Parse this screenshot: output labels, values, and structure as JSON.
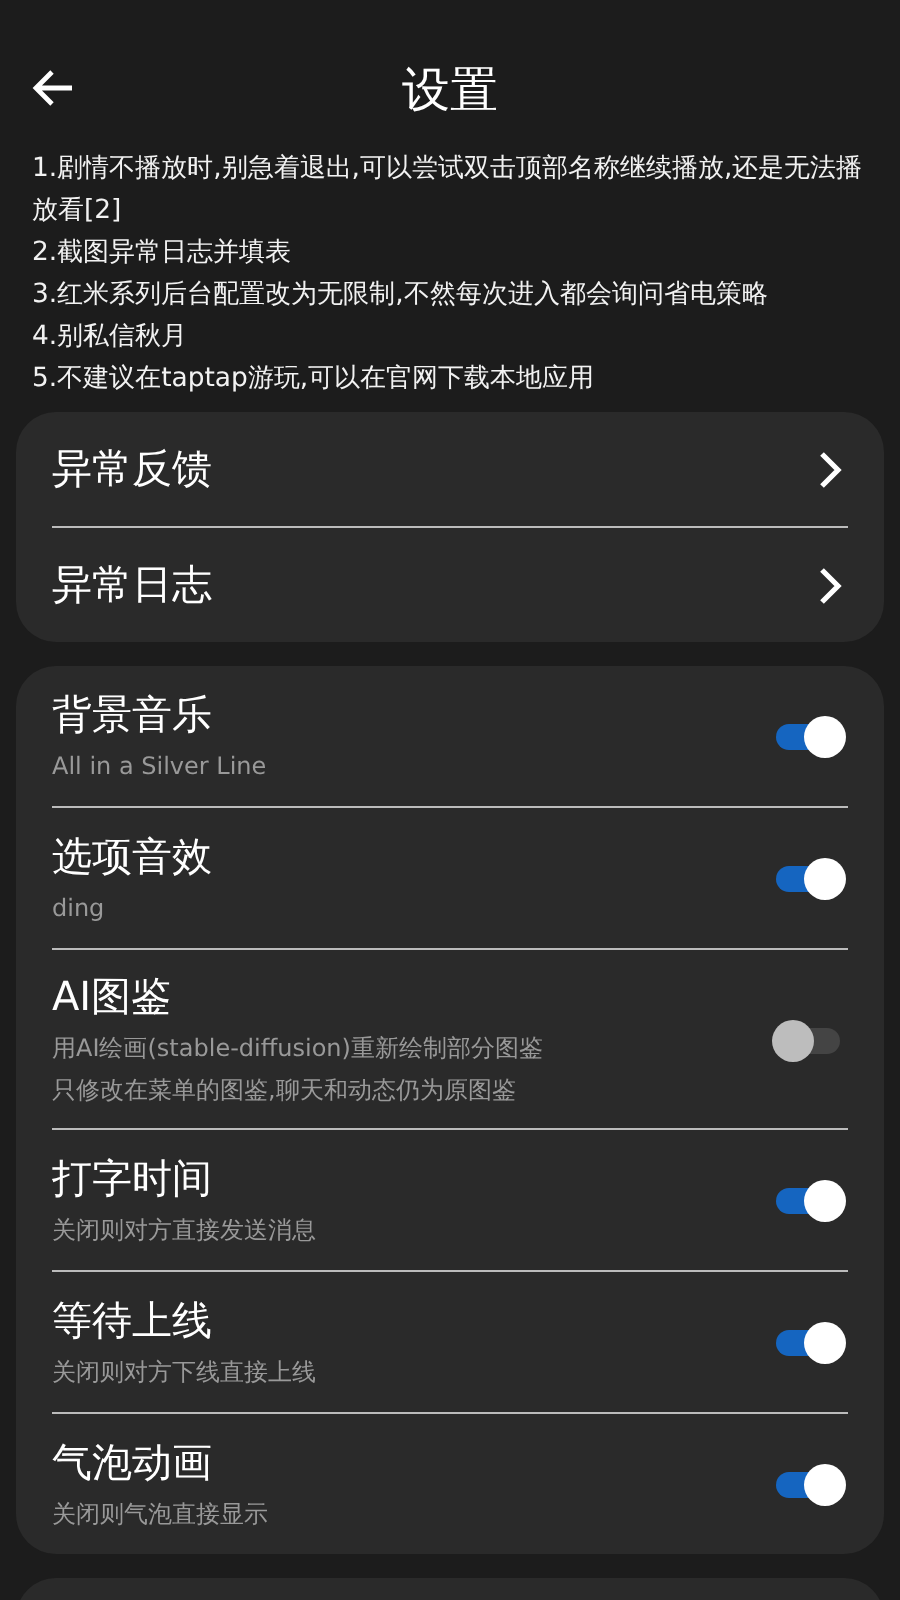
{
  "header": {
    "title": "设置"
  },
  "notes": [
    "1.剧情不播放时,别急着退出,可以尝试双击顶部名称继续播放,还是无法播放看[2]",
    "2.截图异常日志并填表",
    "3.红米系列后台配置改为无限制,不然每次进入都会询问省电策略",
    "4.别私信秋月",
    "5.不建议在taptap游玩,可以在官网下载本地应用"
  ],
  "links": [
    {
      "label": "异常反馈"
    },
    {
      "label": "异常日志"
    }
  ],
  "settings": [
    {
      "label": "背景音乐",
      "subtitle": [
        "All in a Silver Line"
      ],
      "on": true
    },
    {
      "label": "选项音效",
      "subtitle": [
        "ding"
      ],
      "on": true
    },
    {
      "label": "AI图鉴",
      "subtitle": [
        "用AI绘画(stable-diffusion)重新绘制部分图鉴",
        "只修改在菜单的图鉴,聊天和动态仍为原图鉴"
      ],
      "on": false
    },
    {
      "label": "打字时间",
      "subtitle": [
        "关闭则对方直接发送消息"
      ],
      "on": true
    },
    {
      "label": "等待上线",
      "subtitle": [
        "关闭则对方下线直接上线"
      ],
      "on": true
    },
    {
      "label": "气泡动画",
      "subtitle": [
        "关闭则气泡直接显示"
      ],
      "on": true
    }
  ]
}
